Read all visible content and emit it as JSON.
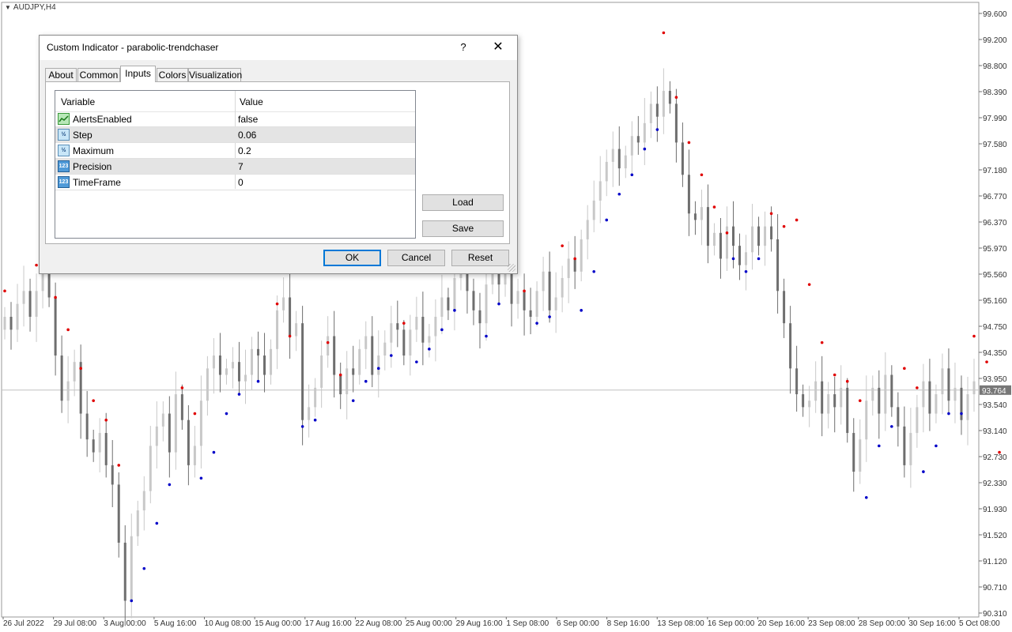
{
  "window": {
    "symbol": "AUDJPY,H4"
  },
  "dialog": {
    "title": "Custom Indicator - parabolic-trendchaser",
    "help_label": "?",
    "close_label": "✕",
    "tabs": [
      "About",
      "Common",
      "Inputs",
      "Colors",
      "Visualization"
    ],
    "active_tab": "Inputs",
    "grid": {
      "headers": [
        "Variable",
        "Value"
      ],
      "rows": [
        {
          "icon": "bool-icon",
          "icon_text": "",
          "name": "AlertsEnabled",
          "value": "false"
        },
        {
          "icon": "double-icon",
          "icon_text": "½",
          "name": "Step",
          "value": "0.06"
        },
        {
          "icon": "double-icon",
          "icon_text": "½",
          "name": "Maximum",
          "value": "0.2"
        },
        {
          "icon": "int-icon",
          "icon_text": "123",
          "name": "Precision",
          "value": "7"
        },
        {
          "icon": "int-icon",
          "icon_text": "123",
          "name": "TimeFrame",
          "value": "0"
        }
      ]
    },
    "buttons": {
      "load": "Load",
      "save": "Save",
      "ok": "OK",
      "cancel": "Cancel",
      "reset": "Reset"
    }
  },
  "price_axis": {
    "ticks": [
      "99.600",
      "99.200",
      "98.800",
      "98.390",
      "97.990",
      "97.580",
      "97.180",
      "96.770",
      "96.370",
      "95.970",
      "95.560",
      "95.160",
      "94.750",
      "94.350",
      "93.950",
      "93.540",
      "93.140",
      "92.730",
      "92.330",
      "91.930",
      "91.520",
      "91.120",
      "90.710",
      "90.310"
    ],
    "current_price": "93.764",
    "current_price_value": 93.764,
    "min": 90.31,
    "max": 99.6
  },
  "time_axis": {
    "ticks": [
      "26 Jul 2022",
      "29 Jul 08:00",
      "3 Aug 00:00",
      "5 Aug 16:00",
      "10 Aug 08:00",
      "15 Aug 00:00",
      "17 Aug 16:00",
      "22 Aug 08:00",
      "25 Aug 00:00",
      "29 Aug 16:00",
      "1 Sep 08:00",
      "6 Sep 00:00",
      "8 Sep 16:00",
      "13 Sep 08:00",
      "16 Sep 00:00",
      "20 Sep 16:00",
      "23 Sep 08:00",
      "28 Sep 00:00",
      "30 Sep 16:00",
      "5 Oct 08:00"
    ]
  },
  "chart_data": {
    "type": "candlestick",
    "colors": {
      "up": "#c8c8c8",
      "down": "#6e6e6e",
      "sar_above": "#e00000",
      "sar_below": "#0000c8",
      "price_line": "#c0c0c0"
    },
    "closes": [
      94.9,
      94.7,
      95.1,
      95.3,
      94.9,
      95.3,
      95.6,
      95.2,
      94.3,
      93.6,
      93.9,
      94.2,
      93.4,
      93.0,
      92.8,
      93.1,
      92.6,
      92.3,
      91.4,
      90.5,
      91.5,
      91.9,
      92.2,
      92.9,
      93.2,
      93.4,
      92.8,
      93.7,
      93.3,
      92.6,
      92.9,
      93.6,
      94.1,
      94.3,
      94.0,
      94.1,
      94.2,
      93.9,
      94.0,
      94.4,
      94.3,
      94.0,
      94.4,
      95.0,
      95.2,
      94.6,
      94.8,
      93.3,
      93.5,
      93.8,
      94.3,
      94.6,
      94.0,
      93.7,
      94.1,
      94.0,
      94.4,
      94.6,
      94.0,
      94.3,
      94.5,
      94.8,
      94.7,
      94.3,
      94.7,
      94.9,
      94.5,
      94.6,
      94.9,
      95.2,
      95.0,
      95.5,
      95.9,
      95.3,
      95.0,
      94.8,
      95.4,
      95.8,
      95.4,
      95.6,
      95.1,
      95.3,
      95.0,
      94.9,
      95.3,
      95.6,
      95.0,
      95.2,
      95.5,
      95.8,
      95.6,
      96.1,
      96.4,
      96.7,
      97.0,
      97.3,
      97.5,
      97.2,
      97.4,
      97.7,
      97.6,
      97.9,
      98.2,
      98.0,
      98.4,
      98.2,
      97.6,
      97.1,
      96.5,
      96.4,
      96.6,
      96.0,
      96.2,
      95.8,
      96.3,
      96.0,
      95.7,
      95.9,
      96.3,
      96.0,
      96.3,
      96.1,
      95.3,
      94.8,
      94.1,
      93.7,
      93.5,
      93.6,
      93.9,
      93.4,
      93.7,
      93.5,
      93.8,
      93.1,
      92.5,
      93.0,
      93.6,
      93.8,
      93.4,
      94.0,
      93.5,
      93.2,
      92.6,
      93.1,
      93.5,
      93.9,
      93.4,
      93.7,
      94.1,
      93.6,
      93.8,
      93.3,
      93.7,
      93.9
    ],
    "sar": [
      {
        "i": 0,
        "v": 95.3,
        "pos": "above"
      },
      {
        "i": 5,
        "v": 95.7,
        "pos": "above"
      },
      {
        "i": 8,
        "v": 95.2,
        "pos": "above"
      },
      {
        "i": 10,
        "v": 94.7,
        "pos": "above"
      },
      {
        "i": 12,
        "v": 94.1,
        "pos": "above"
      },
      {
        "i": 14,
        "v": 93.6,
        "pos": "above"
      },
      {
        "i": 16,
        "v": 93.3,
        "pos": "above"
      },
      {
        "i": 18,
        "v": 92.6,
        "pos": "above"
      },
      {
        "i": 20,
        "v": 90.5,
        "pos": "below"
      },
      {
        "i": 22,
        "v": 91.0,
        "pos": "below"
      },
      {
        "i": 24,
        "v": 91.7,
        "pos": "below"
      },
      {
        "i": 26,
        "v": 92.3,
        "pos": "below"
      },
      {
        "i": 28,
        "v": 93.8,
        "pos": "above"
      },
      {
        "i": 30,
        "v": 93.4,
        "pos": "above"
      },
      {
        "i": 31,
        "v": 92.4,
        "pos": "below"
      },
      {
        "i": 33,
        "v": 92.8,
        "pos": "below"
      },
      {
        "i": 35,
        "v": 93.4,
        "pos": "below"
      },
      {
        "i": 37,
        "v": 93.7,
        "pos": "below"
      },
      {
        "i": 40,
        "v": 93.9,
        "pos": "below"
      },
      {
        "i": 43,
        "v": 95.1,
        "pos": "above"
      },
      {
        "i": 45,
        "v": 94.6,
        "pos": "above"
      },
      {
        "i": 47,
        "v": 93.2,
        "pos": "below"
      },
      {
        "i": 49,
        "v": 93.3,
        "pos": "below"
      },
      {
        "i": 51,
        "v": 94.5,
        "pos": "above"
      },
      {
        "i": 53,
        "v": 94.0,
        "pos": "above"
      },
      {
        "i": 55,
        "v": 93.6,
        "pos": "below"
      },
      {
        "i": 57,
        "v": 93.9,
        "pos": "below"
      },
      {
        "i": 59,
        "v": 94.1,
        "pos": "below"
      },
      {
        "i": 61,
        "v": 94.3,
        "pos": "below"
      },
      {
        "i": 63,
        "v": 94.8,
        "pos": "above"
      },
      {
        "i": 65,
        "v": 94.2,
        "pos": "below"
      },
      {
        "i": 67,
        "v": 94.4,
        "pos": "below"
      },
      {
        "i": 69,
        "v": 94.7,
        "pos": "below"
      },
      {
        "i": 71,
        "v": 95.0,
        "pos": "below"
      },
      {
        "i": 73,
        "v": 95.6,
        "pos": "above"
      },
      {
        "i": 75,
        "v": 95.9,
        "pos": "above"
      },
      {
        "i": 76,
        "v": 94.6,
        "pos": "below"
      },
      {
        "i": 78,
        "v": 95.1,
        "pos": "below"
      },
      {
        "i": 80,
        "v": 95.6,
        "pos": "above"
      },
      {
        "i": 82,
        "v": 95.3,
        "pos": "above"
      },
      {
        "i": 84,
        "v": 94.8,
        "pos": "below"
      },
      {
        "i": 86,
        "v": 94.9,
        "pos": "below"
      },
      {
        "i": 88,
        "v": 96.0,
        "pos": "above"
      },
      {
        "i": 90,
        "v": 95.8,
        "pos": "above"
      },
      {
        "i": 91,
        "v": 95.0,
        "pos": "below"
      },
      {
        "i": 93,
        "v": 95.6,
        "pos": "below"
      },
      {
        "i": 95,
        "v": 96.4,
        "pos": "below"
      },
      {
        "i": 97,
        "v": 96.8,
        "pos": "below"
      },
      {
        "i": 99,
        "v": 97.1,
        "pos": "below"
      },
      {
        "i": 101,
        "v": 97.5,
        "pos": "below"
      },
      {
        "i": 103,
        "v": 97.8,
        "pos": "below"
      },
      {
        "i": 104,
        "v": 99.3,
        "pos": "above"
      },
      {
        "i": 106,
        "v": 98.3,
        "pos": "above"
      },
      {
        "i": 108,
        "v": 97.6,
        "pos": "above"
      },
      {
        "i": 110,
        "v": 97.1,
        "pos": "above"
      },
      {
        "i": 112,
        "v": 96.6,
        "pos": "above"
      },
      {
        "i": 114,
        "v": 96.2,
        "pos": "above"
      },
      {
        "i": 115,
        "v": 95.8,
        "pos": "below"
      },
      {
        "i": 117,
        "v": 95.6,
        "pos": "below"
      },
      {
        "i": 119,
        "v": 95.8,
        "pos": "below"
      },
      {
        "i": 121,
        "v": 96.5,
        "pos": "above"
      },
      {
        "i": 123,
        "v": 96.3,
        "pos": "above"
      },
      {
        "i": 125,
        "v": 96.4,
        "pos": "above"
      },
      {
        "i": 127,
        "v": 95.4,
        "pos": "above"
      },
      {
        "i": 129,
        "v": 94.5,
        "pos": "above"
      },
      {
        "i": 131,
        "v": 94.0,
        "pos": "above"
      },
      {
        "i": 133,
        "v": 93.9,
        "pos": "above"
      },
      {
        "i": 135,
        "v": 93.6,
        "pos": "above"
      },
      {
        "i": 136,
        "v": 92.1,
        "pos": "below"
      },
      {
        "i": 138,
        "v": 92.9,
        "pos": "below"
      },
      {
        "i": 140,
        "v": 93.2,
        "pos": "below"
      },
      {
        "i": 142,
        "v": 94.1,
        "pos": "above"
      },
      {
        "i": 144,
        "v": 93.8,
        "pos": "above"
      },
      {
        "i": 145,
        "v": 92.5,
        "pos": "below"
      },
      {
        "i": 147,
        "v": 92.9,
        "pos": "below"
      },
      {
        "i": 149,
        "v": 93.4,
        "pos": "below"
      },
      {
        "i": 151,
        "v": 93.4,
        "pos": "below"
      },
      {
        "i": 153,
        "v": 94.6,
        "pos": "above"
      },
      {
        "i": 155,
        "v": 94.2,
        "pos": "above"
      },
      {
        "i": 157,
        "v": 92.8,
        "pos": "above"
      }
    ]
  }
}
